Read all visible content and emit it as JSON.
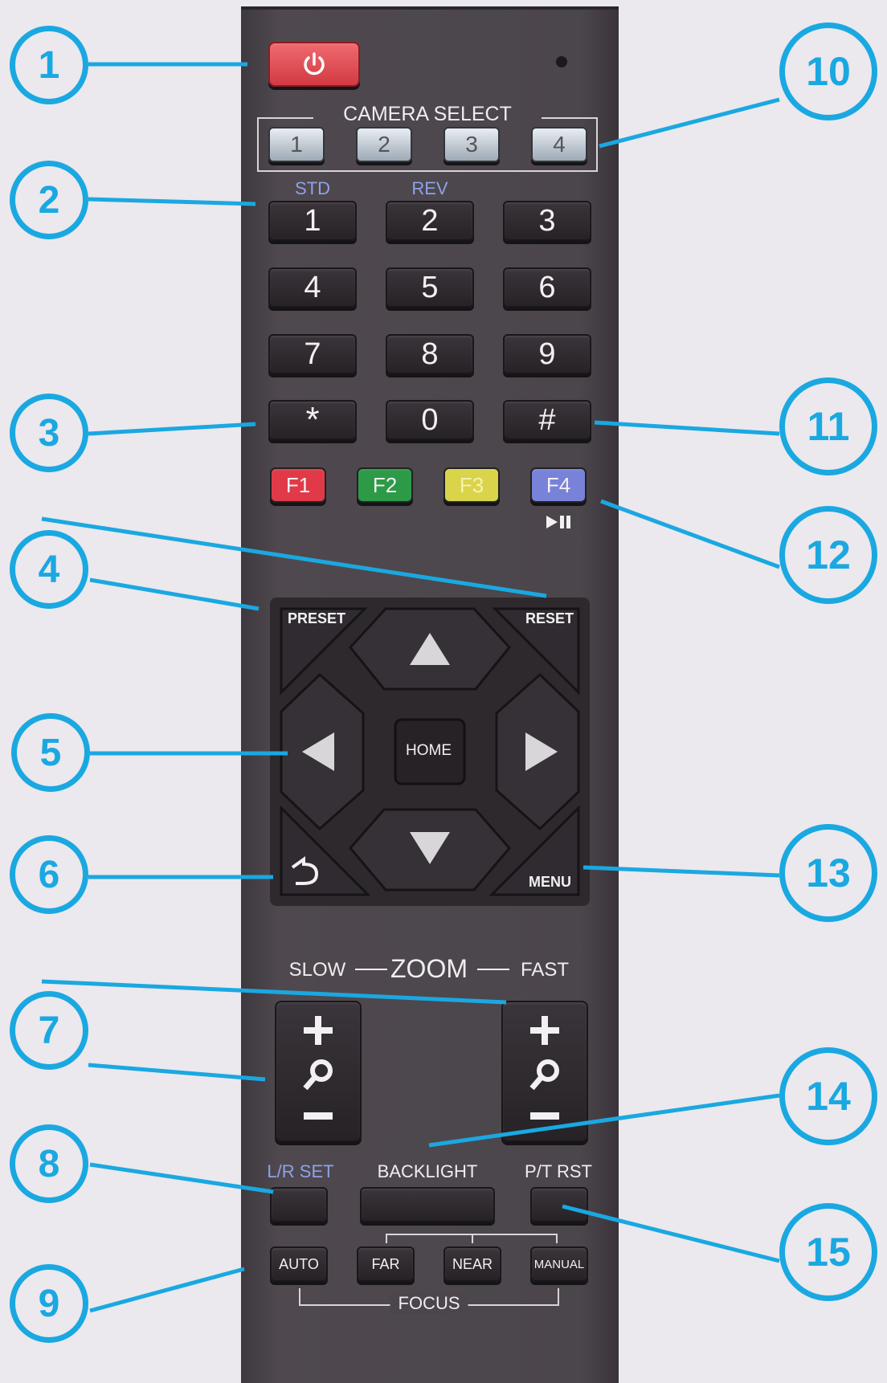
{
  "power": {
    "icon": "power-icon",
    "color": "#e24b50"
  },
  "camera_select": {
    "title": "CAMERA SELECT",
    "buttons": [
      "1",
      "2",
      "3",
      "4"
    ]
  },
  "keypad": {
    "mode_labels": {
      "std": "STD",
      "rev": "REV"
    },
    "keys": [
      "1",
      "2",
      "3",
      "4",
      "5",
      "6",
      "7",
      "8",
      "9",
      "*",
      "0",
      "#"
    ]
  },
  "function_keys": [
    {
      "label": "F1",
      "color": "#e03a48"
    },
    {
      "label": "F2",
      "color": "#2d9a48"
    },
    {
      "label": "F3",
      "color": "#d9d44a"
    },
    {
      "label": "F4",
      "color": "#7882d8"
    }
  ],
  "play_pause_icon": "play-pause-icon",
  "dpad": {
    "preset": "PRESET",
    "reset": "RESET",
    "home": "HOME",
    "menu": "MENU",
    "back_icon": "back-arrow-icon"
  },
  "zoom": {
    "slow": "SLOW",
    "title": "ZOOM",
    "fast": "FAST"
  },
  "bottom_labels": {
    "lr_set": "L/R SET",
    "backlight": "BACKLIGHT",
    "pt_rst": "P/T RST"
  },
  "focus": {
    "auto": "AUTO",
    "far": "FAR",
    "near": "NEAR",
    "manual": "MANUAL",
    "title": "FOCUS"
  },
  "callouts": [
    "1",
    "2",
    "3",
    "4",
    "5",
    "6",
    "7",
    "8",
    "9",
    "10",
    "11",
    "12",
    "13",
    "14",
    "15"
  ],
  "accent_color": "#1aa8e1"
}
